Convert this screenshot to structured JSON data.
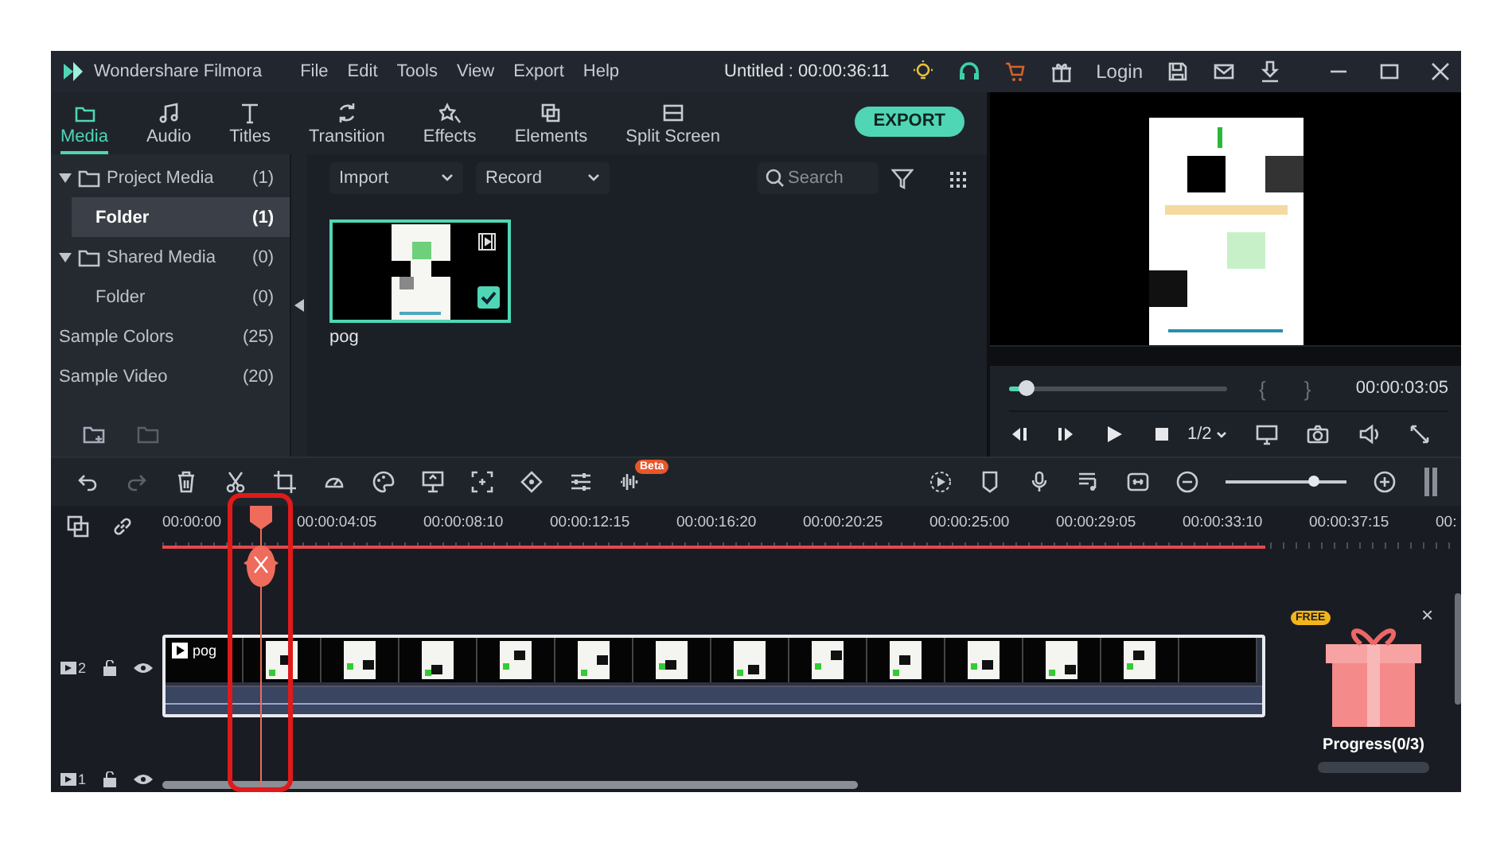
{
  "title_bar": {
    "app_name": "Wondershare Filmora",
    "menu": [
      "File",
      "Edit",
      "Tools",
      "View",
      "Export",
      "Help"
    ],
    "project": "Untitled : 00:00:36:11",
    "login": "Login"
  },
  "tabs": [
    {
      "label": "Media",
      "selected": true,
      "kind": "folder"
    },
    {
      "label": "Audio",
      "selected": false,
      "kind": "music"
    },
    {
      "label": "Titles",
      "selected": false,
      "kind": "text"
    },
    {
      "label": "Transition",
      "selected": false,
      "kind": "transition"
    },
    {
      "label": "Effects",
      "selected": false,
      "kind": "effects"
    },
    {
      "label": "Elements",
      "selected": false,
      "kind": "elements"
    },
    {
      "label": "Split Screen",
      "selected": false,
      "kind": "split"
    }
  ],
  "export_button": "EXPORT",
  "sidebar": {
    "items": [
      {
        "label": "Project Media",
        "count": "(1)",
        "selected": false,
        "expanded": true,
        "children": [
          {
            "label": "Folder",
            "count": "(1)",
            "selected": true
          }
        ]
      },
      {
        "label": "Shared Media",
        "count": "(0)",
        "selected": false,
        "expanded": true,
        "children": [
          {
            "label": "Folder",
            "count": "(0)",
            "selected": false
          }
        ]
      },
      {
        "label": "Sample Colors",
        "count": "(25)",
        "selected": false
      },
      {
        "label": "Sample Video",
        "count": "(20)",
        "selected": false
      }
    ]
  },
  "media_toolbar": {
    "import": "Import",
    "record": "Record",
    "search": {
      "placeholder": "Search"
    }
  },
  "media_items": [
    {
      "name": "pog",
      "selected": true
    }
  ],
  "preview": {
    "level": 0.08,
    "mark_in": "{",
    "mark_out": "}",
    "timecode": "00:00:03:05",
    "speed": "1/2"
  },
  "timeline": {
    "beta_badge": "Beta",
    "zoom": {
      "level": 0.72
    },
    "ruler": [
      "00:00:00",
      "00:00:04:05",
      "00:00:08:10",
      "00:00:12:15",
      "00:00:16:20",
      "00:00:20:25",
      "00:00:25:00",
      "00:00:29:05",
      "00:00:33:10",
      "00:00:37:15",
      "00:"
    ],
    "tracks": [
      {
        "number": "2",
        "clip": {
          "name": "pog"
        }
      },
      {
        "number": "1"
      }
    ]
  },
  "promo": {
    "badge": "FREE",
    "close": "×",
    "progress": "Progress(0/3)",
    "level": 0
  }
}
